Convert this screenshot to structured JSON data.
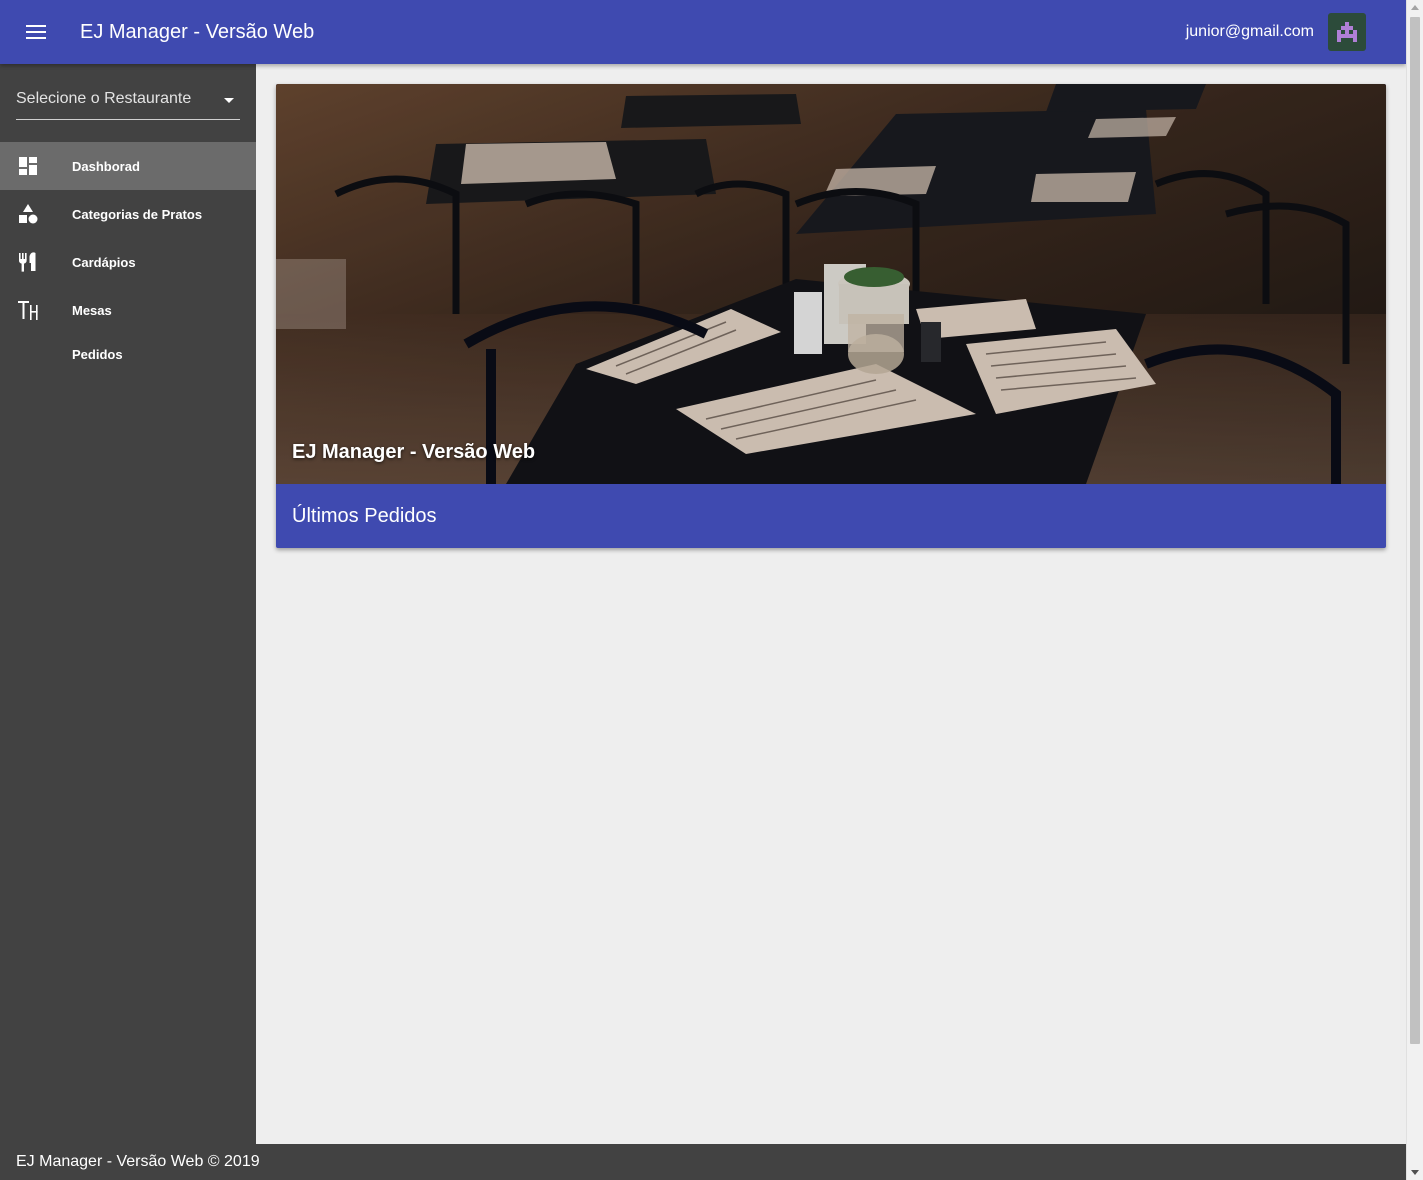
{
  "appbar": {
    "menu_icon": "menu-icon",
    "title": "EJ Manager - Versão Web",
    "user_email": "junior@gmail.com",
    "avatar_icon": "identicon-avatar"
  },
  "sidebar": {
    "restaurant_select": {
      "placeholder": "Selecione o Restaurante",
      "icon": "arrow-drop-down-icon"
    },
    "items": [
      {
        "label": "Dashborad",
        "icon": "dashboard-icon",
        "active": true
      },
      {
        "label": "Categorias de Pratos",
        "icon": "category-shapes-icon",
        "active": false
      },
      {
        "label": "Cardápios",
        "icon": "restaurant-menu-icon",
        "active": false
      },
      {
        "label": "Mesas",
        "icon": "table-icon",
        "active": false
      },
      {
        "label": "Pedidos",
        "icon": "",
        "active": false
      }
    ]
  },
  "main": {
    "hero_title": "EJ Manager - Versão Web",
    "card_title": "Últimos Pedidos"
  },
  "footer": {
    "text": "EJ Manager - Versão Web © 2019"
  },
  "colors": {
    "primary": "#3f4ab0",
    "sidebar": "#424242",
    "sidebar_active": "#6b6b6b",
    "background": "#eeeeee"
  }
}
